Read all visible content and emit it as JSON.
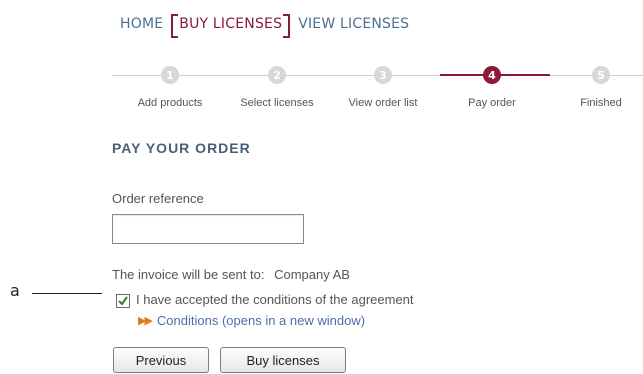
{
  "nav": {
    "home": "HOME",
    "buy": "BUY LICENSES",
    "view": "VIEW LICENSES"
  },
  "steps": [
    {
      "num": "1",
      "label": "Add products"
    },
    {
      "num": "2",
      "label": "Select licenses"
    },
    {
      "num": "3",
      "label": "View order list"
    },
    {
      "num": "4",
      "label": "Pay order"
    },
    {
      "num": "5",
      "label": "Finished"
    }
  ],
  "active_step": 4,
  "page": {
    "title": "PAY YOUR ORDER",
    "order_reference_label": "Order reference",
    "order_reference_value": "",
    "invoice_text": "The invoice will be sent to:",
    "company": "Company AB",
    "agree_label": "I have accepted the conditions of the agreement",
    "conditions_link": "Conditions (opens in a new window)"
  },
  "callout": {
    "letter": "a"
  },
  "buttons": {
    "previous": "Previous",
    "buy": "Buy licenses"
  },
  "colors": {
    "brand": "#8b1a3a",
    "link": "#4c6fa8",
    "nav": "#4f6f8f",
    "arrow": "#e07b1a"
  },
  "icons": {
    "checkbox_check": "check-icon",
    "link_arrows": "double-arrow-icon"
  }
}
